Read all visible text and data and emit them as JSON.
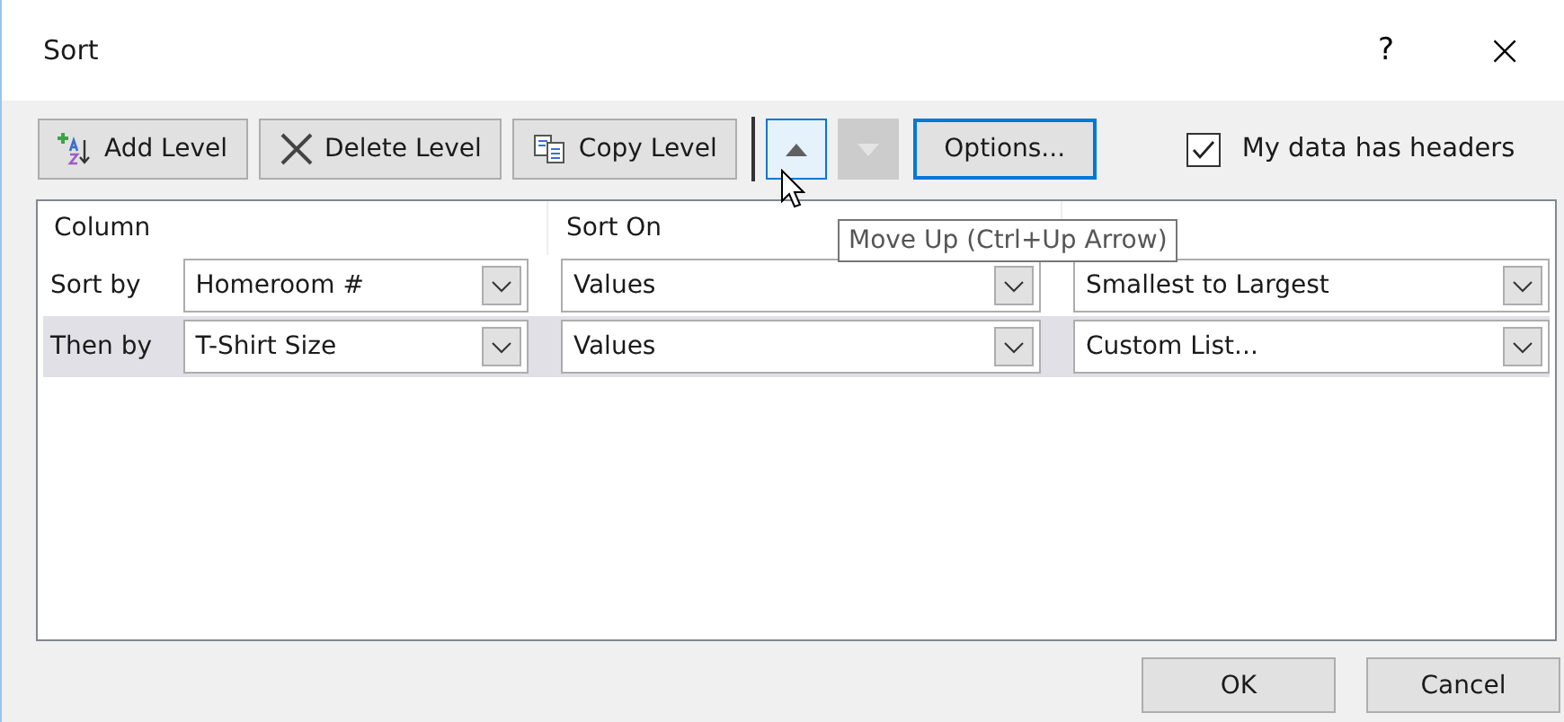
{
  "window": {
    "title": "Sort",
    "help": "?",
    "close": "×"
  },
  "toolbar": [
    {
      "kind": "add",
      "label": "Add Level",
      "disabled": false
    },
    {
      "kind": "delete",
      "label": "Delete Level",
      "disabled": false
    },
    {
      "kind": "copy",
      "label": "Copy Level",
      "disabled": false
    },
    {
      "kind": "up",
      "disabled": false,
      "selected": true
    },
    {
      "kind": "down",
      "disabled": true,
      "selected": false
    },
    {
      "kind": "options",
      "label": "Options...",
      "disabled": false
    }
  ],
  "headers_checkbox": {
    "label": "My data has headers",
    "checked": true
  },
  "columns": [
    "Column",
    "Sort On"
  ],
  "rows": [
    {
      "label": "Sort by",
      "selected": false,
      "column": "Homeroom #",
      "sort_on": "Values",
      "order": "Smallest to Largest"
    },
    {
      "label": "Then by",
      "selected": true,
      "column": "T-Shirt Size",
      "sort_on": "Values",
      "order": "Custom List..."
    }
  ],
  "tooltip": "Move Up (Ctrl+Up Arrow)",
  "buttons": [
    "OK",
    "Cancel"
  ]
}
